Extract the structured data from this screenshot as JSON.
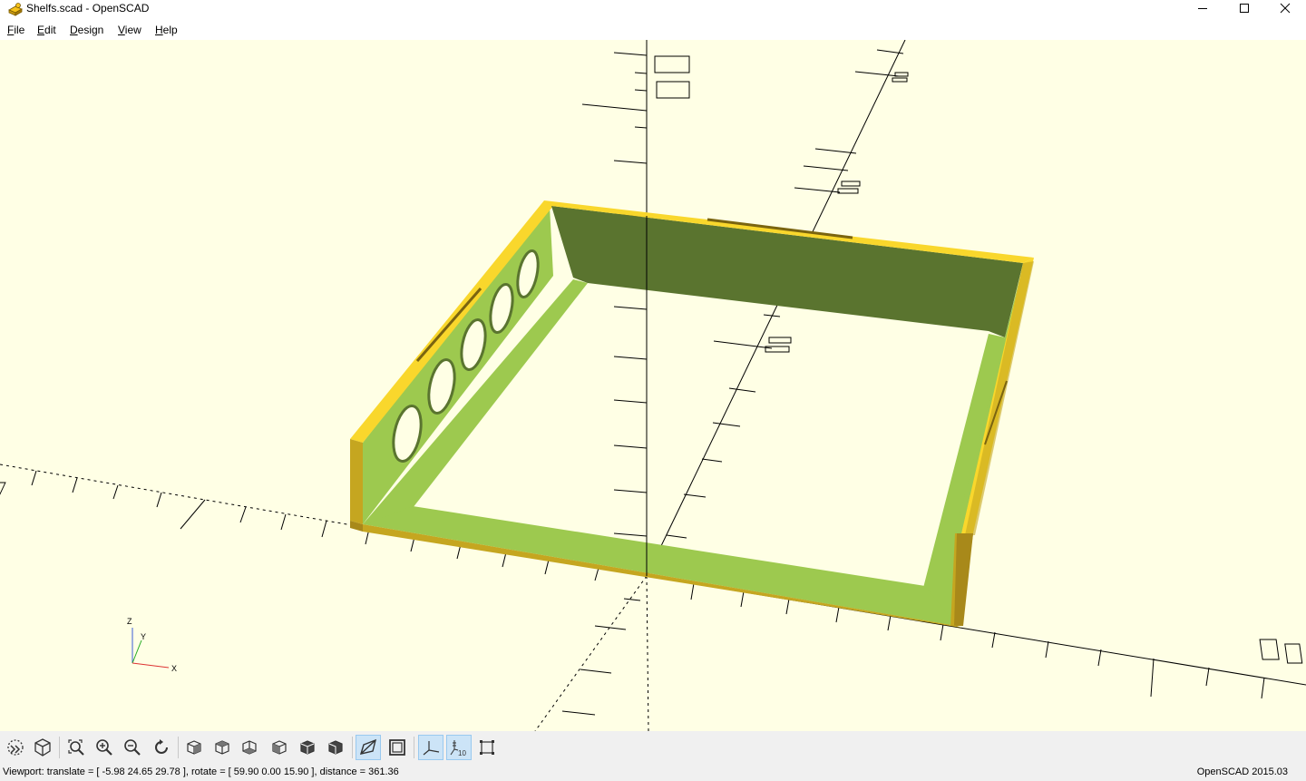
{
  "window": {
    "title": "Shelfs.scad - OpenSCAD",
    "icon": "openscad-logo-icon",
    "controls": [
      "minimize-icon",
      "maximize-icon",
      "close-icon"
    ]
  },
  "menu": {
    "file": {
      "mnemonic": "F",
      "rest": "ile"
    },
    "edit": {
      "mnemonic": "E",
      "rest": "dit"
    },
    "design": {
      "mnemonic": "D",
      "rest": "esign"
    },
    "view": {
      "mnemonic": "V",
      "rest": "iew"
    },
    "help": {
      "mnemonic": "H",
      "rest": "elp"
    }
  },
  "viewport": {
    "background": "#ffffe5",
    "axis_labels": {
      "z": "Z",
      "y": "Y",
      "x": "X"
    },
    "scale_labels": {
      "upper": "100",
      "left": "100",
      "right": "100",
      "mid_left": "50",
      "center": "50",
      "mid_right": "10"
    },
    "model_colors": {
      "top_edge": "#f9d72c",
      "side": "#9dc94f",
      "shadow": "#5a742f",
      "dark_side": "#c5a620"
    }
  },
  "toolbar": {
    "buttons": [
      {
        "name": "preview-button",
        "icon": "preview-icon"
      },
      {
        "name": "render-button",
        "icon": "render-icon"
      },
      {
        "name": "view-all-button",
        "icon": "view-all-icon"
      },
      {
        "name": "zoom-in-button",
        "icon": "zoom-in-icon"
      },
      {
        "name": "zoom-out-button",
        "icon": "zoom-out-icon"
      },
      {
        "name": "reset-view-button",
        "icon": "reset-view-icon"
      },
      {
        "name": "view-right-button",
        "icon": "view-right-icon"
      },
      {
        "name": "view-top-button",
        "icon": "view-top-icon"
      },
      {
        "name": "view-bottom-button",
        "icon": "view-bottom-icon"
      },
      {
        "name": "view-left-button",
        "icon": "view-left-icon"
      },
      {
        "name": "view-front-button",
        "icon": "view-front-icon"
      },
      {
        "name": "view-back-button",
        "icon": "view-back-icon"
      },
      {
        "name": "perspective-button",
        "icon": "perspective-icon",
        "active": true
      },
      {
        "name": "orthogonal-button",
        "icon": "orthogonal-icon"
      },
      {
        "name": "show-axes-button",
        "icon": "axes-icon",
        "active": true
      },
      {
        "name": "show-scale-button",
        "icon": "scale-markers-icon",
        "active": true
      },
      {
        "name": "show-edges-button",
        "icon": "edges-icon"
      }
    ]
  },
  "status": {
    "viewport": "Viewport: translate = [ -5.98 24.65 29.78 ], rotate = [ 59.90 0.00 15.90 ], distance = 361.36",
    "version": "OpenSCAD 2015.03"
  }
}
